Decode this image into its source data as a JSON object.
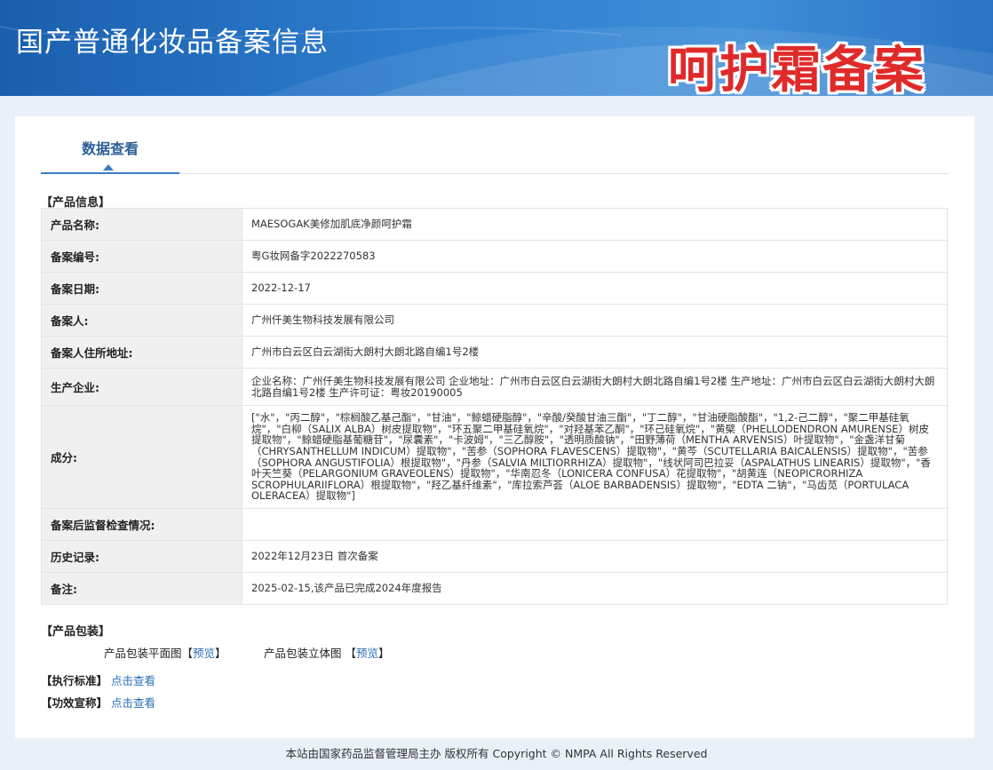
{
  "header": {
    "title": "国产普通化妆品备案信息",
    "watermark": "呵护霜备案"
  },
  "tabs": [
    {
      "label": "数据查看"
    }
  ],
  "product_info": {
    "section_title": "【产品信息】",
    "rows": [
      {
        "key": "产品名称:",
        "value": "MAESOGAK美修加肌底净颜呵护霜"
      },
      {
        "key": "备案编号:",
        "value": "粤G妆网备字2022270583"
      },
      {
        "key": "备案日期:",
        "value": "2022-12-17"
      },
      {
        "key": "备案人:",
        "value": "广州仟美生物科技发展有限公司"
      },
      {
        "key": "备案人住所地址:",
        "value": "广州市白云区白云湖街大朗村大朗北路自编1号2楼"
      },
      {
        "key": "生产企业:",
        "value": "企业名称：广州仟美生物科技发展有限公司 企业地址：广州市白云区白云湖街大朗村大朗北路自编1号2楼 生产地址：广州市白云区白云湖街大朗村大朗北路自编1号2楼 生产许可证：粤妆20190005"
      },
      {
        "key": "成分:",
        "value": "[\"水\"，\"丙二醇\"，\"棕榈酸乙基己酯\"，\"甘油\"，\"鲸蜡硬脂醇\"，\"辛酸/癸酸甘油三酯\"，\"丁二醇\"，\"甘油硬脂酸酯\"，\"1,2-己二醇\"，\"聚二甲基硅氧烷\"，\"白柳（SALIX ALBA）树皮提取物\"，\"环五聚二甲基硅氧烷\"，\"对羟基苯乙酮\"，\"环己硅氧烷\"，\"黄檗（PHELLODENDRON AMURENSE）树皮提取物\"，\"鲸蜡硬脂基葡糖苷\"，\"尿囊素\"，\"卡波姆\"，\"三乙醇胺\"，\"透明质酸钠\"，\"田野薄荷（MENTHA ARVENSIS）叶提取物\"，\"金盏洋甘菊（CHRYSANTHELLUM INDICUM）提取物\"，\"苦参（SOPHORA FLAVESCENS）提取物\"，\"黄芩（SCUTELLARIA BAICALENSIS）提取物\"，\"苦参（SOPHORA ANGUSTIFOLIA）根提取物\"，\"丹参（SALVIA MILTIORRHIZA）提取物\"，\"线状阿司巴拉妥（ASPALATHUS LINEARIS）提取物\"，\"香叶天竺葵（PELARGONIUM GRAVEOLENS）提取物\"，\"华南忍冬（LONICERA CONFUSA）花提取物\"，\"胡黄连（NEOPICRORHIZA SCROPHULARIIFLORA）根提取物\"，\"羟乙基纤维素\"，\"库拉索芦荟（ALOE BARBADENSIS）提取物\"，\"EDTA 二钠\"，\"马齿苋（PORTULACA OLERACEA）提取物\"]"
      },
      {
        "key": "备案后监督检查情况:",
        "value": ""
      },
      {
        "key": "历史记录:",
        "value": "2022年12月23日 首次备案"
      },
      {
        "key": "备注:",
        "value": "2025-02-15,该产品已完成2024年度报告"
      }
    ]
  },
  "packaging": {
    "section_title": "【产品包装】",
    "flat_label": "产品包装平面图",
    "solid_label": "产品包装立体图",
    "preview_link": "预览",
    "bracket_open": "【",
    "bracket_close": "】"
  },
  "standard": {
    "label": "【执行标准】",
    "link": "点击查看"
  },
  "efficacy": {
    "label": "【功效宣称】",
    "link": "点击查看"
  },
  "footer": {
    "text": "本站由国家药品监督管理局主办 版权所有 Copyright © NMPA All Rights Reserved"
  }
}
